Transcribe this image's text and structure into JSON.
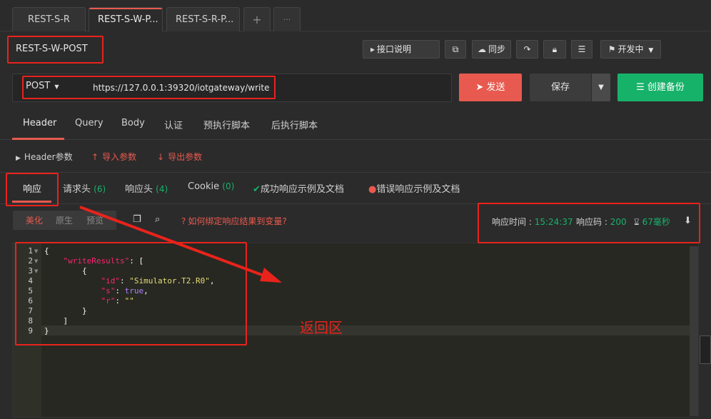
{
  "tabs": [
    {
      "label": "REST-S-R"
    },
    {
      "label": "REST-S-W-P..."
    },
    {
      "label": "REST-S-R-P..."
    }
  ],
  "tab_add": "+",
  "tab_more": "···",
  "toolbar": {
    "doc_title": "REST-S-W-POST",
    "api_doc": "接口说明",
    "sync": "同步",
    "env": "开发中"
  },
  "request": {
    "method": "POST",
    "url": "https://127.0.0.1:39320/iotgateway/write",
    "send": "发送",
    "save": "保存",
    "backup": "创建备份"
  },
  "req_tabs": [
    "Header",
    "Query",
    "Body",
    "认证",
    "预执行脚本",
    "后执行脚本"
  ],
  "params": {
    "header_params": "Header参数",
    "import_params": "导入参数",
    "export_params": "导出参数"
  },
  "resp_tabs": {
    "response": "响应",
    "req_headers": "请求头",
    "req_headers_count": "(6)",
    "resp_headers": "响应头",
    "resp_headers_count": "(4)",
    "cookie": "Cookie",
    "cookie_count": "(0)",
    "success_example": "成功响应示例及文档",
    "error_example": "错误响应示例及文档"
  },
  "format": {
    "beautify": "美化",
    "raw": "原生",
    "preview": "预览",
    "help": "如何绑定响应结果到变量?"
  },
  "meta": {
    "time_label": "响应时间 :",
    "time_value": "15:24:37",
    "code_label": "响应码 :",
    "code_value": "200",
    "duration": "67毫秒"
  },
  "code_lines": [
    "{",
    "    \"writeResults\": [",
    "        {",
    "            \"id\": \"Simulator.T2.R0\",",
    "            \"s\": true,",
    "            \"r\": \"\"",
    "        }",
    "    ]",
    "}"
  ],
  "annotation": "返回区",
  "colors": {
    "accent": "#e85a4f",
    "green": "#17b26a",
    "annotation_red": "#e8231c"
  }
}
